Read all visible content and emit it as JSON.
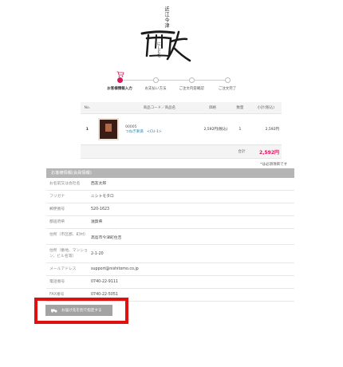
{
  "brand": {
    "tagline": "近江今津",
    "logo_text": "西友",
    "logo_reading": "にしとも"
  },
  "steps": [
    {
      "label": "お客様情報入力",
      "active": true
    },
    {
      "label": "お支払い方法",
      "active": false
    },
    {
      "label": "ご注文内容確認",
      "active": false
    },
    {
      "label": "ご注文完了",
      "active": false
    }
  ],
  "cart": {
    "headers": [
      "No.",
      "",
      "商品コード／商品名",
      "価格",
      "数量",
      "小計(税込)"
    ],
    "items": [
      {
        "no": "1",
        "code": "00005",
        "name": "つねぎ楽満　<CU-1>",
        "price": "2,592円(税込)",
        "qty": "1",
        "subtotal": "2,592円"
      }
    ],
    "total_label": "合計",
    "total_value": "2,592円"
  },
  "required_note": "*は必須項目です",
  "customer": {
    "title": "お客様情報(会員情報)",
    "rows": [
      {
        "label": "お名前又は会社名",
        "value": "西友太郎"
      },
      {
        "label": "フリガナ",
        "value": "ニシトモタロ"
      },
      {
        "label": "郵便番号",
        "value": "520-1623"
      },
      {
        "label": "都道府県",
        "value": "滋賀県"
      },
      {
        "label": "住所（市区郡、町村）",
        "value": "高島市今津町住吉"
      },
      {
        "label": "住所（番地、マンション、ビル名等）",
        "value": "2-1-20"
      },
      {
        "label": "メールアドレス",
        "value": "support@nishitomo.co.jp"
      },
      {
        "label": "電話番号",
        "value": "0740-22-9111"
      },
      {
        "label": "FAX番号",
        "value": "0740-22-5051"
      }
    ]
  },
  "delivery_button": "お届け先を別で指定する",
  "colors": {
    "accent": "#d6195e",
    "highlight": "#e01010",
    "button": "#a3a3a3"
  }
}
